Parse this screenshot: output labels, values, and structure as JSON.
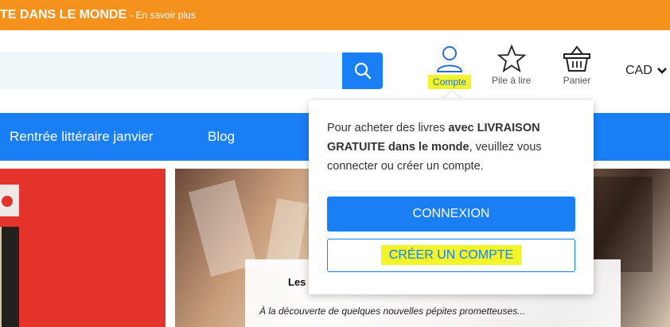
{
  "promo": {
    "bold_text": "TE DANS LE MONDE",
    "link_text": "- En savoir plus"
  },
  "header": {
    "search_placeholder": "",
    "account_label": "Compte",
    "wishlist_label": "Pile à lire",
    "cart_label": "Panier",
    "currency": "CAD"
  },
  "nav": {
    "items": [
      {
        "label": "Rentrée littéraire janvier"
      },
      {
        "label": "Blog"
      }
    ]
  },
  "banner": {
    "caption_title": "Les",
    "caption_text": "À la découverte de quelques nouvelles pépites prometteuses..."
  },
  "popup": {
    "text_before": "Pour acheter des livres ",
    "text_bold_1": "avec LIVRAISON GRATUITE dans le monde",
    "text_after": ", veuillez vous connecter ou créer un compte.",
    "login_button": "CONNEXION",
    "create_button": "CRÉER UN COMPTE"
  },
  "colors": {
    "promo_bg": "#f5921e",
    "primary_blue": "#1a7ff5",
    "highlight_yellow": "#f3f32a",
    "banner_red": "#e3332a"
  },
  "icons": {
    "search": "search-icon",
    "account": "user-icon",
    "wishlist": "star-icon",
    "cart": "basket-icon",
    "currency_dropdown": "chevron-down-icon"
  }
}
